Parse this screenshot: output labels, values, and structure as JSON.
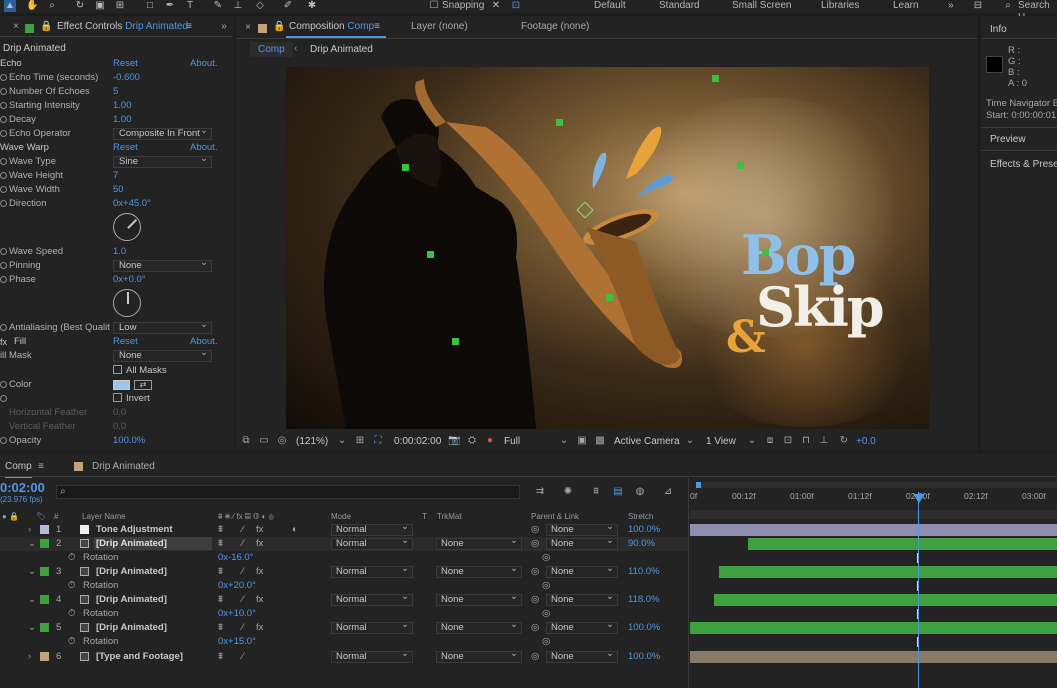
{
  "toolbar": {
    "snapping_label": "Snapping",
    "workspaces": [
      "Default",
      "Standard",
      "Small Screen",
      "Libraries",
      "Learn"
    ],
    "more": "»",
    "search_label": "Search H"
  },
  "effect_controls": {
    "tab_label": "Effect Controls",
    "tab_layer": "Drip Animated",
    "layer_title": "Drip Animated",
    "echo": {
      "name": "Echo",
      "reset": "Reset",
      "about": "About.",
      "echo_time_label": "Echo Time (seconds)",
      "echo_time": "-0.600",
      "num_echoes_label": "Number Of Echoes",
      "num_echoes": "5",
      "starting_intensity_label": "Starting Intensity",
      "starting_intensity": "1.00",
      "decay_label": "Decay",
      "decay": "1.00",
      "operator_label": "Echo Operator",
      "operator": "Composite In Front"
    },
    "wave_warp": {
      "name": "Wave Warp",
      "reset": "Reset",
      "about": "About.",
      "wave_type_label": "Wave Type",
      "wave_type": "Sine",
      "wave_height_label": "Wave Height",
      "wave_height": "7",
      "wave_width_label": "Wave Width",
      "wave_width": "50",
      "direction_label": "Direction",
      "direction": "0x+45.0°",
      "wave_speed_label": "Wave Speed",
      "wave_speed": "1.0",
      "pinning_label": "Pinning",
      "pinning": "None",
      "phase_label": "Phase",
      "phase": "0x+0.0°",
      "antialiasing_label": "Antialiasing (Best Qualit",
      "antialiasing": "Low"
    },
    "fill": {
      "name": "Fill",
      "reset": "Reset",
      "about": "About.",
      "mask_label": "ill Mask",
      "mask": "None",
      "all_masks_label": "All Masks",
      "color_label": "Color",
      "color_value": "#9cc4ec",
      "invert_label": "Invert",
      "h_feather_label": "Horizontal Feather",
      "h_feather": "0.0",
      "v_feather_label": "Vertical Feather",
      "v_feather": "0.0",
      "opacity_label": "Opacity",
      "opacity": "100.0%"
    }
  },
  "composition": {
    "tab_label": "Composition",
    "tab_comp": "Comp",
    "layer_tab": "Layer (none)",
    "footage_tab": "Footage (none)",
    "breadcrumb_comp": "Comp",
    "breadcrumb_layer": "Drip Animated",
    "artwork": {
      "word1": "Bop",
      "amp": "&",
      "word2": "Skip"
    },
    "footer": {
      "zoom": "(121%)",
      "timecode": "0:00:02:00",
      "resolution": "Full",
      "camera": "Active Camera",
      "view": "1 View",
      "exposure": "+0.0"
    }
  },
  "info": {
    "tab_label": "Info",
    "r": "R :",
    "g": "G :",
    "b": "B :",
    "a": "A :  0",
    "time_nav": "Time Navigator B",
    "start": "Start: 0:00:00:01",
    "preview": "Preview",
    "effects": "Effects & Presets"
  },
  "timeline": {
    "tab_label": "Comp",
    "tab2_label": "Drip Animated",
    "current_time": "0:02:00",
    "fps": "(23.976 fps)",
    "search_placeholder": "",
    "headers": {
      "num": "#",
      "layer_name": "Layer Name",
      "mode": "Mode",
      "t": "T",
      "trkmat": "TrkMat",
      "parent": "Parent & Link",
      "stretch": "Stretch"
    },
    "ruler": [
      "0f",
      "00:12f",
      "01:00f",
      "01:12f",
      "02:00f",
      "02:12f",
      "03:00f"
    ],
    "playhead_seconds": 2.0,
    "layers": [
      {
        "num": "1",
        "name": "Tone Adjustment",
        "mode": "Normal",
        "trkmat": "",
        "parent": "None",
        "stretch": "100.0%",
        "color": "#e8e8e8",
        "rotation": ""
      },
      {
        "num": "2",
        "name": "[Drip Animated]",
        "mode": "Normal",
        "trkmat": "None",
        "parent": "None",
        "stretch": "90.0%",
        "color": "#3fa03f",
        "rotation": "0x-16.0°"
      },
      {
        "num": "3",
        "name": "[Drip Animated]",
        "mode": "Normal",
        "trkmat": "None",
        "parent": "None",
        "stretch": "110.0%",
        "color": "#3fa03f",
        "rotation": "0x+20.0°"
      },
      {
        "num": "4",
        "name": "[Drip Animated]",
        "mode": "Normal",
        "trkmat": "None",
        "parent": "None",
        "stretch": "118.0%",
        "color": "#3fa03f",
        "rotation": "0x+10.0°"
      },
      {
        "num": "5",
        "name": "[Drip Animated]",
        "mode": "Normal",
        "trkmat": "None",
        "parent": "None",
        "stretch": "100.0%",
        "color": "#3fa03f",
        "rotation": "0x+15.0°"
      },
      {
        "num": "6",
        "name": "[Type and Footage]",
        "mode": "Normal",
        "trkmat": "None",
        "parent": "None",
        "stretch": "100.0%",
        "color": "#c2a27a",
        "rotation": ""
      }
    ],
    "rotation_label": "Rotation"
  }
}
